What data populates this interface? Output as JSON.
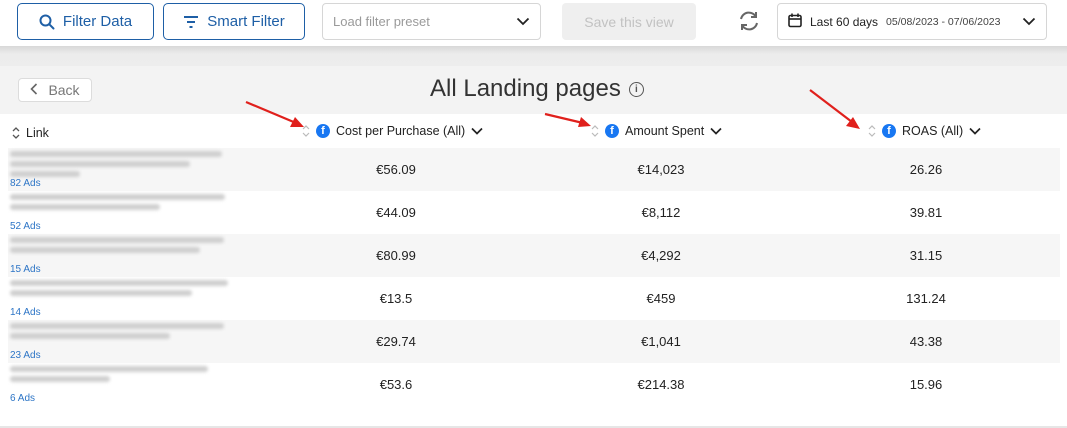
{
  "toolbar": {
    "filter_data_label": "Filter Data",
    "smart_filter_label": "Smart Filter",
    "preset_placeholder": "Load filter preset",
    "save_view_label": "Save this view",
    "date_label": "Last 60 days",
    "date_range": "05/08/2023 - 07/06/2023"
  },
  "header": {
    "back_label": "Back",
    "title": "All Landing pages",
    "info_glyph": "i"
  },
  "columns": {
    "link": "Link",
    "cpp": "Cost per Purchase (All)",
    "amount": "Amount Spent",
    "roas": "ROAS (All)"
  },
  "rows": [
    {
      "ads": "82 Ads",
      "cpp": "€56.09",
      "amount": "€14,023",
      "roas": "26.26"
    },
    {
      "ads": "52 Ads",
      "cpp": "€44.09",
      "amount": "€8,112",
      "roas": "39.81"
    },
    {
      "ads": "15 Ads",
      "cpp": "€80.99",
      "amount": "€4,292",
      "roas": "31.15"
    },
    {
      "ads": "14 Ads",
      "cpp": "€13.5",
      "amount": "€459",
      "roas": "131.24"
    },
    {
      "ads": "23 Ads",
      "cpp": "€29.74",
      "amount": "€1,041",
      "roas": "43.38"
    },
    {
      "ads": "6 Ads",
      "cpp": "€53.6",
      "amount": "€214.38",
      "roas": "15.96"
    }
  ],
  "colors": {
    "primary": "#1e5fa6",
    "facebook": "#1877f2",
    "annotation_arrow": "#e0201c",
    "ads_link": "#2d75c6"
  },
  "icons": {
    "filter_data": "search-icon",
    "smart_filter": "filter-icon",
    "refresh": "refresh-icon",
    "calendar": "calendar-icon",
    "facebook": "facebook-icon"
  }
}
